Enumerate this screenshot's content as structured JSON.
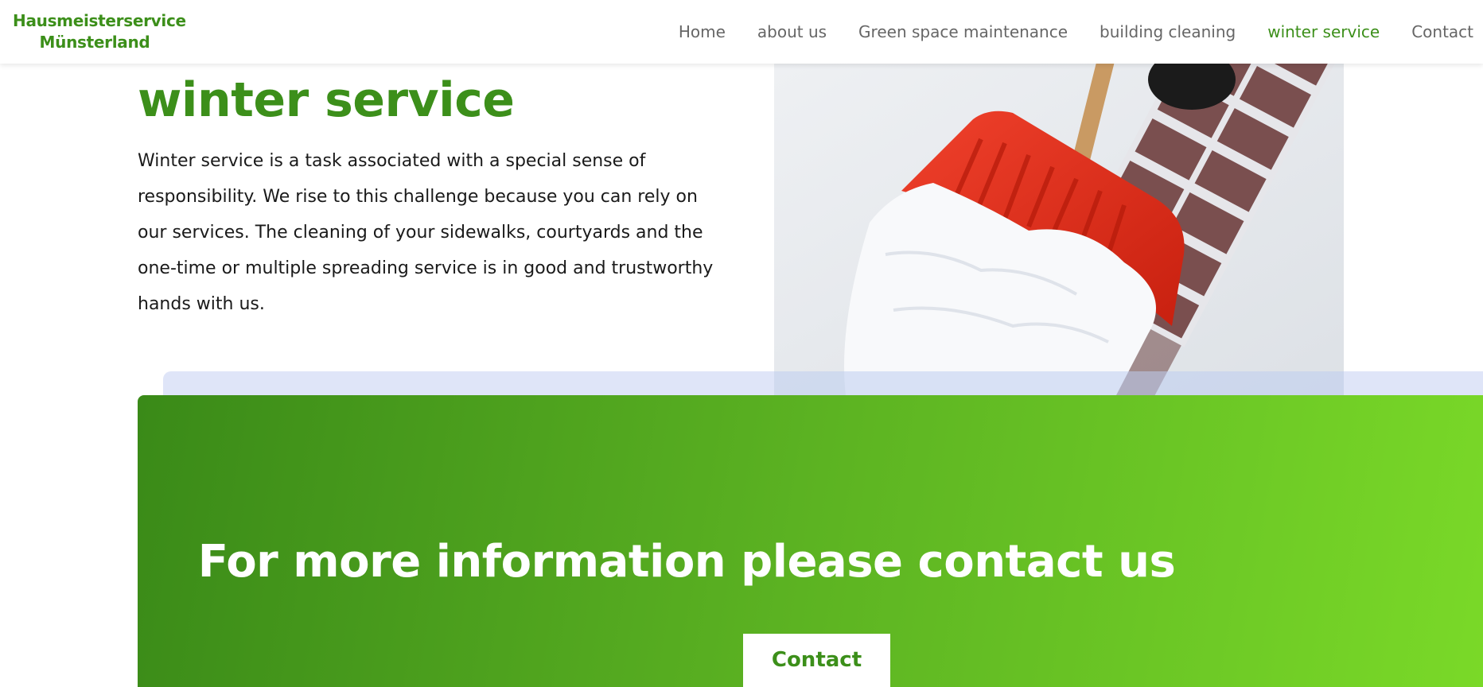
{
  "header": {
    "logo_line1": "Hausmeisterservice",
    "logo_line2": "Münsterland",
    "nav": [
      {
        "label": "Home"
      },
      {
        "label": "about us"
      },
      {
        "label": "Green space maintenance"
      },
      {
        "label": "building cleaning"
      },
      {
        "label": "winter service",
        "active": true
      },
      {
        "label": "Contact"
      }
    ]
  },
  "main": {
    "title": "winter service",
    "description": "Winter service is a task associated with a special sense of responsibility. We rise to this challenge because you can rely on our services. The cleaning of your sidewalks, courtyards and the one-time or multiple spreading service is in good and trustworthy hands with us.",
    "image_subject": "red snow shovel pushing snow on a brick pavement"
  },
  "cta": {
    "title": "For more information please contact us",
    "button_label": "Contact"
  },
  "colors": {
    "brand_green": "#3c8f1a",
    "gradient_start": "#3a8a18",
    "gradient_end": "#7ad928",
    "band": "#dfe5f8",
    "nav_text": "#666666"
  }
}
